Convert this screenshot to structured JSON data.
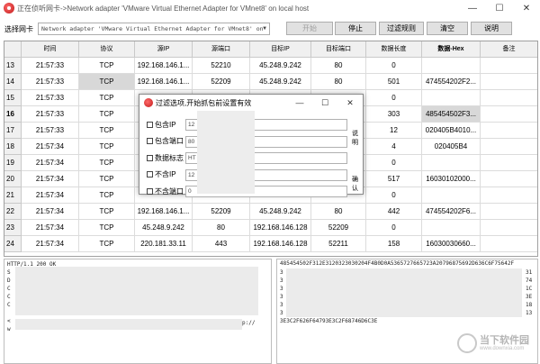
{
  "window": {
    "title": "正在侦听网卡->Network adapter 'VMware Virtual Ethernet Adapter for VMnet8' on local host",
    "min_icon": "minimize-icon",
    "max_icon": "maximize-icon",
    "close_icon": "close-icon"
  },
  "toolbar": {
    "adapter_label": "选择网卡",
    "adapter_value": "Network adapter 'VMware Virtual Ethernet Adapter for VMnet8' on",
    "start": "开始",
    "stop": "停止",
    "filter": "过滤规则",
    "clear": "清空",
    "help": "说明"
  },
  "table": {
    "columns": [
      "时间",
      "协议",
      "源IP",
      "源端口",
      "目标IP",
      "目标端口",
      "数据长度",
      "数据-Hex",
      "备注"
    ],
    "rows": [
      {
        "n": "13",
        "time": "21:57:33",
        "proto": "TCP",
        "src": "192.168.146.1...",
        "sport": "52210",
        "dst": "45.248.9.242",
        "dport": "80",
        "len": "0",
        "hex": "",
        "note": ""
      },
      {
        "n": "14",
        "time": "21:57:33",
        "proto": "TCP",
        "src": "192.168.146.1...",
        "sport": "52209",
        "dst": "45.248.9.242",
        "dport": "80",
        "len": "501",
        "hex": "474554202F2...",
        "note": ""
      },
      {
        "n": "15",
        "time": "21:57:33",
        "proto": "TCP",
        "src": "",
        "sport": "",
        "dst": "",
        "dport": "",
        "len": "0",
        "hex": "",
        "note": ""
      },
      {
        "n": "16",
        "time": "21:57:33",
        "proto": "TCP",
        "src": "",
        "sport": "",
        "dst": "",
        "dport": "",
        "len": "303",
        "hex": "485454502F3...",
        "note": ""
      },
      {
        "n": "17",
        "time": "21:57:33",
        "proto": "TCP",
        "src": "",
        "sport": "",
        "dst": "",
        "dport": "",
        "len": "12",
        "hex": "020405B4010...",
        "note": ""
      },
      {
        "n": "18",
        "time": "21:57:34",
        "proto": "TCP",
        "src": "",
        "sport": "",
        "dst": "",
        "dport": "",
        "len": "4",
        "hex": "020405B4",
        "note": ""
      },
      {
        "n": "19",
        "time": "21:57:34",
        "proto": "TCP",
        "src": "",
        "sport": "",
        "dst": "",
        "dport": "",
        "len": "0",
        "hex": "",
        "note": ""
      },
      {
        "n": "20",
        "time": "21:57:34",
        "proto": "TCP",
        "src": "",
        "sport": "",
        "dst": "",
        "dport": "",
        "len": "517",
        "hex": "16030102000...",
        "note": ""
      },
      {
        "n": "21",
        "time": "21:57:34",
        "proto": "TCP",
        "src": "",
        "sport": "",
        "dst": "",
        "dport": "",
        "len": "0",
        "hex": "",
        "note": ""
      },
      {
        "n": "22",
        "time": "21:57:34",
        "proto": "TCP",
        "src": "192.168.146.1...",
        "sport": "52209",
        "dst": "45.248.9.242",
        "dport": "80",
        "len": "442",
        "hex": "474554202F6...",
        "note": ""
      },
      {
        "n": "23",
        "time": "21:57:34",
        "proto": "TCP",
        "src": "45.248.9.242",
        "sport": "80",
        "dst": "192.168.146.128",
        "dport": "52209",
        "len": "0",
        "hex": "",
        "note": ""
      },
      {
        "n": "24",
        "time": "21:57:34",
        "proto": "TCP",
        "src": "220.181.33.11",
        "sport": "443",
        "dst": "192.168.146.128",
        "dport": "52211",
        "len": "158",
        "hex": "16030030660...",
        "note": ""
      }
    ]
  },
  "left_pane": {
    "lines": [
      "HTTP/1.1 200 OK",
      "S",
      "D",
      "C",
      "C",
      "C",
      "",
      "<",
      "w"
    ],
    "tail": "p://"
  },
  "right_pane": {
    "first_line": "485454502F312E3120323030204F4B0D0A5365727665723A20796875692D636C6F75642F",
    "left_chars": [
      "3",
      "3",
      "3",
      "3",
      "3",
      "3"
    ],
    "right_chars": [
      "31",
      "74",
      "1C",
      "3E",
      "18",
      "13"
    ],
    "last_line": "3E3C2F626F64793E3C2F68746D6C3E"
  },
  "dialog": {
    "title": "过滤选项,开始抓包前设置有效",
    "filters": [
      {
        "label": "包含IP",
        "value": "12"
      },
      {
        "label": "包含端口",
        "value": "80"
      },
      {
        "label": "数据标志",
        "value": "HT"
      },
      {
        "label": "不含IP",
        "value": "12"
      },
      {
        "label": "不含端口",
        "value": "0"
      }
    ],
    "help": "说明",
    "ok": "确认"
  },
  "watermark": {
    "cn": "当下软件园",
    "en": "www.downxia.com"
  }
}
